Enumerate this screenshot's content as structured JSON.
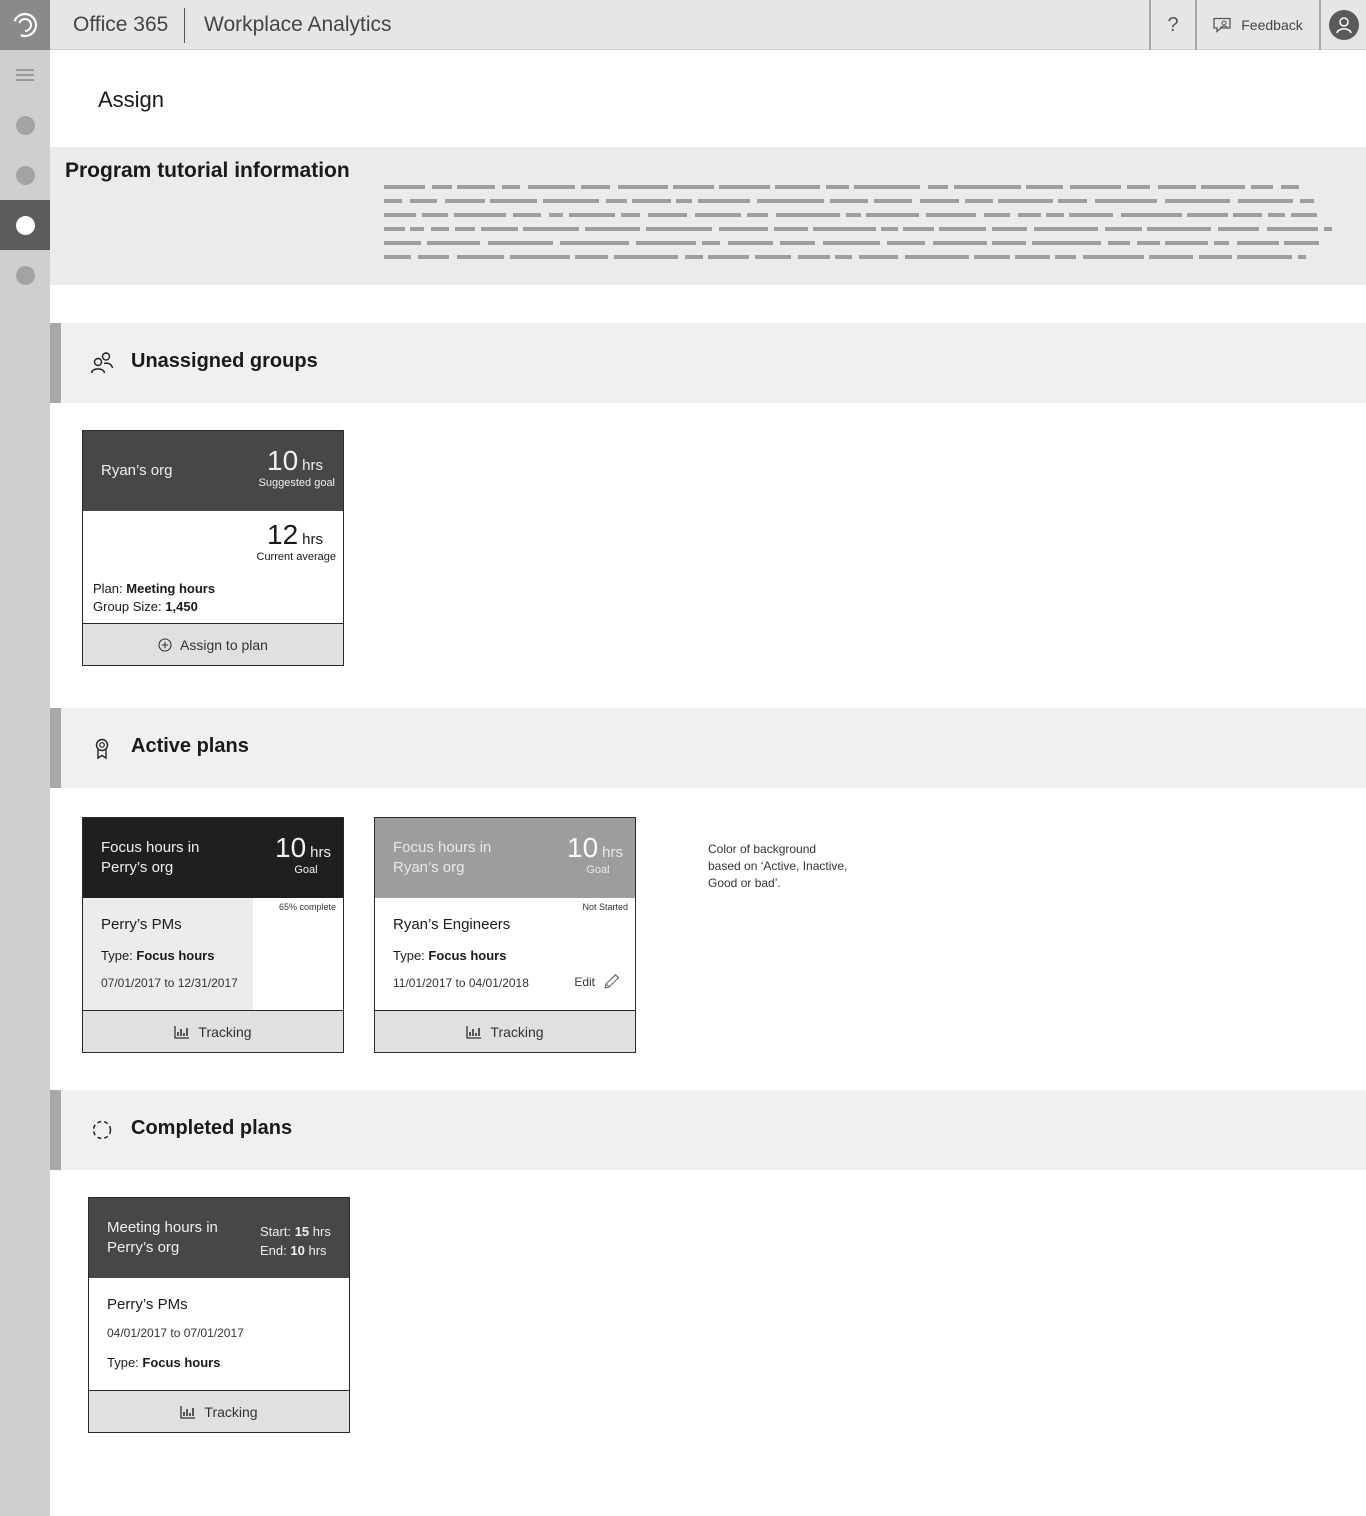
{
  "header": {
    "app_name": "Office 365",
    "product_name": "Workplace Analytics",
    "help_label": "?",
    "feedback_label": "Feedback"
  },
  "page": {
    "title": "Assign"
  },
  "tutorial": {
    "title": "Program tutorial information"
  },
  "sections": {
    "unassigned": {
      "title": "Unassigned groups"
    },
    "active": {
      "title": "Active plans"
    },
    "completed": {
      "title": "Completed plans"
    }
  },
  "unassigned_card": {
    "name": "Ryan’s org",
    "goal_value": "10",
    "goal_unit": "hrs",
    "goal_caption": "Suggested goal",
    "avg_value": "12",
    "avg_unit": "hrs",
    "avg_caption": "Current average",
    "plan_label": "Plan:",
    "plan_value": "Meeting hours",
    "size_label": "Group Size:",
    "size_value": "1,450",
    "action_label": "Assign to plan"
  },
  "active_cards": [
    {
      "name_line1": "Focus hours in",
      "name_line2": "Perry’s org",
      "goal_value": "10",
      "goal_unit": "hrs",
      "goal_caption": "Goal",
      "status": "65% complete",
      "progress": 0.65,
      "group": "Perry’s PMs",
      "type_label": "Type:",
      "type_value": "Focus hours",
      "dates": "07/01/2017 to 12/31/2017",
      "action_label": "Tracking"
    },
    {
      "name_line1": "Focus hours in",
      "name_line2": "Ryan’s org",
      "goal_value": "10",
      "goal_unit": "hrs",
      "goal_caption": "Goal",
      "status": "Not Started",
      "group": "Ryan’s Engineers",
      "type_label": "Type:",
      "type_value": "Focus hours",
      "dates": "11/01/2017 to 04/01/2018",
      "edit_label": "Edit",
      "action_label": "Tracking"
    }
  ],
  "note": {
    "line1": "Color of background",
    "line2": "based on ‘Active, Inactive,",
    "line3": "Good or bad’."
  },
  "completed_card": {
    "name_line1": "Meeting hours in",
    "name_line2": "Perry’s org",
    "start_label": "Start:",
    "start_value": "15",
    "end_label": "End:",
    "end_value": "10",
    "unit": "hrs",
    "group": "Perry’s PMs",
    "dates": "04/01/2017 to 07/01/2017",
    "type_label": "Type:",
    "type_value": "Focus hours",
    "action_label": "Tracking"
  }
}
